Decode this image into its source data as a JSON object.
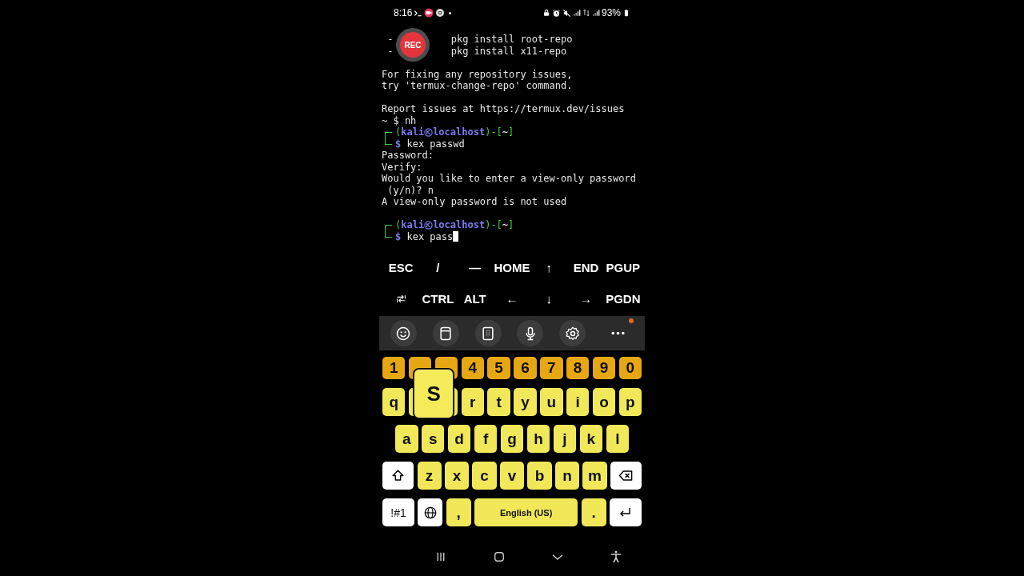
{
  "status_bar": {
    "time": "8:16",
    "battery": "93%"
  },
  "recording_badge": {
    "label": "REC"
  },
  "terminal": {
    "lines": [
      {
        "kind": "columns",
        "parts": [
          " -",
          "pkg install root-repo"
        ]
      },
      {
        "kind": "columns",
        "parts": [
          " -",
          "pkg install x11-repo"
        ]
      },
      {
        "kind": "blank"
      },
      {
        "kind": "text",
        "text": "For fixing any repository issues,"
      },
      {
        "kind": "text",
        "text": "try 'termux-change-repo' command."
      },
      {
        "kind": "blank"
      },
      {
        "kind": "text",
        "text": "Report issues at https://termux.dev/issues"
      },
      {
        "kind": "text",
        "text": "~ $ nh"
      },
      {
        "kind": "prompt",
        "segments": [
          {
            "kind": "frame",
            "text": "("
          },
          {
            "kind": "user",
            "text": "kali"
          },
          {
            "kind": "at-icon"
          },
          {
            "kind": "user",
            "text": "localhost"
          },
          {
            "kind": "frame",
            "text": ")-["
          },
          {
            "kind": "dir",
            "text": "~"
          },
          {
            "kind": "frame",
            "text": "]"
          }
        ],
        "symbol": "$",
        "command": "kex passwd",
        "cursor": false
      },
      {
        "kind": "text",
        "text": "Password:"
      },
      {
        "kind": "text",
        "text": "Verify:"
      },
      {
        "kind": "text",
        "text": "Would you like to enter a view-only password"
      },
      {
        "kind": "text",
        "text": " (y/n)? n"
      },
      {
        "kind": "text",
        "text": "A view-only password is not used"
      },
      {
        "kind": "blank"
      },
      {
        "kind": "prompt",
        "segments": [
          {
            "kind": "frame",
            "text": "("
          },
          {
            "kind": "user",
            "text": "kali"
          },
          {
            "kind": "at-icon"
          },
          {
            "kind": "user",
            "text": "localhost"
          },
          {
            "kind": "frame",
            "text": ")-["
          },
          {
            "kind": "dir",
            "text": "~"
          },
          {
            "kind": "frame",
            "text": "]"
          }
        ],
        "symbol": "$",
        "command": "kex pass",
        "cursor": true
      }
    ]
  },
  "extra_keys": [
    {
      "keys": [
        {
          "kind": "text",
          "label": "ESC"
        },
        {
          "kind": "text",
          "label": "/"
        },
        {
          "kind": "text",
          "label": "—"
        },
        {
          "kind": "text",
          "label": "HOME"
        },
        {
          "kind": "text",
          "label": "↑"
        },
        {
          "kind": "text",
          "label": "END"
        },
        {
          "kind": "text",
          "label": "PGUP"
        }
      ]
    },
    {
      "keys": [
        {
          "kind": "tab"
        },
        {
          "kind": "text",
          "label": "CTRL"
        },
        {
          "kind": "text",
          "label": "ALT"
        },
        {
          "kind": "text",
          "label": "←"
        },
        {
          "kind": "text",
          "label": "↓"
        },
        {
          "kind": "text",
          "label": "→"
        },
        {
          "kind": "text",
          "label": "PGDN"
        }
      ]
    }
  ],
  "keyboard_toolbar": [
    {
      "kind": "emoji",
      "badge": false
    },
    {
      "kind": "clipboard",
      "badge": false
    },
    {
      "kind": "keypad",
      "badge": false
    },
    {
      "kind": "mic",
      "badge": false
    },
    {
      "kind": "settings",
      "badge": false
    },
    {
      "kind": "more",
      "badge": true
    }
  ],
  "keyboard": {
    "rows": [
      {
        "keys": [
          {
            "kind": "number",
            "label": "1"
          },
          {
            "kind": "number"
          },
          {
            "kind": "number"
          },
          {
            "kind": "number",
            "label": "4"
          },
          {
            "kind": "number",
            "label": "5"
          },
          {
            "kind": "number",
            "label": "6"
          },
          {
            "kind": "number",
            "label": "7"
          },
          {
            "kind": "number",
            "label": "8"
          },
          {
            "kind": "number",
            "label": "9"
          },
          {
            "kind": "number",
            "label": "0"
          }
        ]
      },
      {
        "keys": [
          {
            "kind": "letter",
            "label": "q"
          },
          {
            "kind": "letter"
          },
          {
            "kind": "letter"
          },
          {
            "kind": "letter",
            "label": "r"
          },
          {
            "kind": "letter",
            "label": "t"
          },
          {
            "kind": "letter",
            "label": "y"
          },
          {
            "kind": "letter",
            "label": "u"
          },
          {
            "kind": "letter",
            "label": "i"
          },
          {
            "kind": "letter",
            "label": "o"
          },
          {
            "kind": "letter",
            "label": "p"
          }
        ]
      },
      {
        "keys": [
          {
            "kind": "letter",
            "label": "a"
          },
          {
            "kind": "letter",
            "label": "s",
            "preview": "S"
          },
          {
            "kind": "letter",
            "label": "d"
          },
          {
            "kind": "letter",
            "label": "f"
          },
          {
            "kind": "letter",
            "label": "g"
          },
          {
            "kind": "letter",
            "label": "h"
          },
          {
            "kind": "letter",
            "label": "j"
          },
          {
            "kind": "letter",
            "label": "k"
          },
          {
            "kind": "letter",
            "label": "l"
          }
        ]
      },
      {
        "keys": [
          {
            "kind": "shift"
          },
          {
            "kind": "letter",
            "label": "z"
          },
          {
            "kind": "letter",
            "label": "x"
          },
          {
            "kind": "letter",
            "label": "c"
          },
          {
            "kind": "letter",
            "label": "v"
          },
          {
            "kind": "letter",
            "label": "b"
          },
          {
            "kind": "letter",
            "label": "n"
          },
          {
            "kind": "letter",
            "label": "m"
          },
          {
            "kind": "backspace"
          }
        ]
      },
      {
        "keys": [
          {
            "kind": "symbols",
            "label": "!#1"
          },
          {
            "kind": "globe"
          },
          {
            "kind": "letter",
            "label": ","
          },
          {
            "kind": "space",
            "label": "English (US)"
          },
          {
            "kind": "letter",
            "label": "."
          },
          {
            "kind": "enter"
          }
        ]
      }
    ]
  },
  "nav_bar": [
    {
      "kind": "recents"
    },
    {
      "kind": "home"
    },
    {
      "kind": "back"
    },
    {
      "kind": "accessibility"
    }
  ]
}
